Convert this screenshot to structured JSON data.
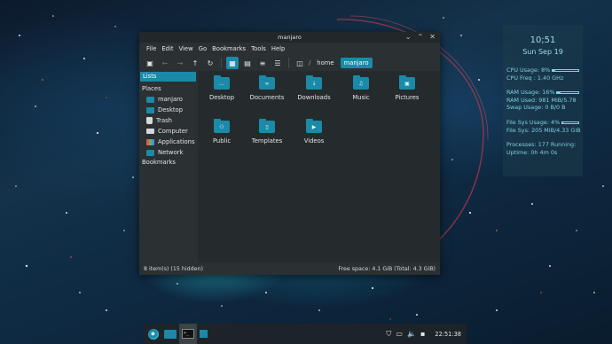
{
  "conky": {
    "time": "10;51",
    "date": "Sun Sep 19",
    "cpu_usage": "CPU Usage: 8%",
    "cpu_usage_fraction": 0.08,
    "cpu_freq": "CPU Freq : 1.40 GHz",
    "ram_usage": "RAM Usage: 16%",
    "ram_usage_fraction": 0.16,
    "ram_used": "RAM Used: 981 MiB/5.78",
    "swap_usage": "Swap Usage: 0 B/0 B",
    "fs_usage": "File Sys Usage:  4%",
    "fs_usage_fraction": 0.04,
    "fs_sys": "File Sys: 205 MiB/4.33 GiB",
    "processes": "Processes:  177    Running:",
    "uptime": "Uptime: 0h 4m 0s"
  },
  "window": {
    "title": "manjaro",
    "controls": {
      "minimize": "⌄",
      "maximize": "⌃",
      "close": "✕"
    },
    "menu": [
      "File",
      "Edit",
      "View",
      "Go",
      "Bookmarks",
      "Tools",
      "Help"
    ],
    "breadcrumb": {
      "root_icon": "/",
      "separator": "/",
      "items": [
        "home",
        "manjaro"
      ]
    },
    "sidebar": {
      "lists_label": "Lists",
      "places_label": "Places",
      "bookmarks_label": "Bookmarks",
      "places": [
        "manjaro",
        "Desktop",
        "Trash",
        "Computer",
        "Applications",
        "Network"
      ]
    },
    "files": [
      {
        "name": "Desktop",
        "glyph": "…"
      },
      {
        "name": "Documents",
        "glyph": "∞"
      },
      {
        "name": "Downloads",
        "glyph": "↓"
      },
      {
        "name": "Music",
        "glyph": "♫"
      },
      {
        "name": "Pictures",
        "glyph": "▣"
      },
      {
        "name": "Public",
        "glyph": "⚇"
      },
      {
        "name": "Templates",
        "glyph": "▯"
      },
      {
        "name": "Videos",
        "glyph": "▶"
      }
    ],
    "status_left": "8 item(s) (15 hidden)",
    "status_right": "Free space: 4.1 GiB (Total: 4.3 GiB)"
  },
  "taskbar": {
    "clock": "22:51:38",
    "terminal_glyph": ">_"
  },
  "colors": {
    "accent": "#1b8aa8",
    "window_bg": "#2b3033",
    "content_bg": "#252a2c",
    "conky_text": "#7fd0e0"
  }
}
